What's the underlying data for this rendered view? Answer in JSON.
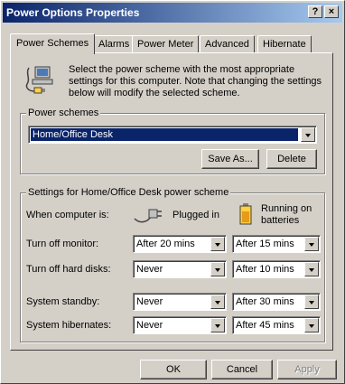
{
  "window": {
    "title": "Power Options Properties",
    "help_button": "?",
    "close_button": "×"
  },
  "tabs": [
    {
      "label": "Power Schemes",
      "active": true
    },
    {
      "label": "Alarms",
      "active": false
    },
    {
      "label": "Power Meter",
      "active": false
    },
    {
      "label": "Advanced",
      "active": false
    },
    {
      "label": "Hibernate",
      "active": false
    }
  ],
  "description": "Select the power scheme with the most appropriate settings for this computer. Note that changing the settings below will modify the selected scheme.",
  "power_schemes": {
    "group_label": "Power schemes",
    "selected": "Home/Office Desk",
    "save_as_label": "Save As...",
    "delete_label": "Delete"
  },
  "settings": {
    "group_label": "Settings for Home/Office Desk power scheme",
    "when_label": "When computer is:",
    "plugged_in": "Plugged in",
    "batteries": "Running on batteries",
    "rows": [
      {
        "label": "Turn off monitor:",
        "plugged": "After 20 mins",
        "battery": "After 15 mins"
      },
      {
        "label": "Turn off hard disks:",
        "plugged": "Never",
        "battery": "After 10 mins"
      },
      {
        "label": "System standby:",
        "plugged": "Never",
        "battery": "After 30 mins"
      },
      {
        "label": "System hibernates:",
        "plugged": "Never",
        "battery": "After 45 mins"
      }
    ]
  },
  "footer": {
    "ok": "OK",
    "cancel": "Cancel",
    "apply": "Apply"
  },
  "colors": {
    "titlebar_start": "#0a246a",
    "titlebar_end": "#a6caf0",
    "face": "#d4d0c8",
    "selection": "#0a246a"
  }
}
